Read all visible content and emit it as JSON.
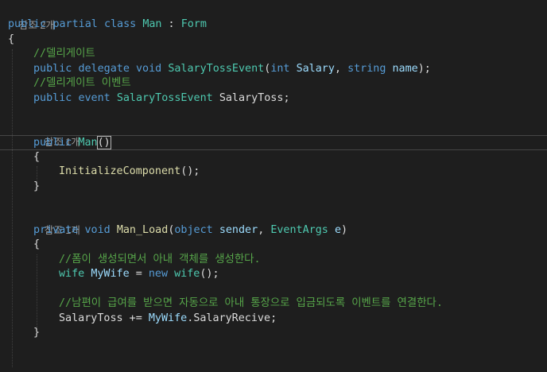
{
  "code": {
    "lens_class_refs": "참조 2개",
    "class_decl": {
      "kw_public": "public",
      "kw_partial": "partial",
      "kw_class": "class",
      "class_name": "Man",
      "colon": " : ",
      "base_type": "Form"
    },
    "open_brace": "{",
    "close_brace": "}",
    "comment_delegate": "//델리게이트",
    "delegate_decl": {
      "kw_public": "public",
      "kw_delegate": "delegate",
      "kw_void": "void",
      "name": "SalaryTossEvent",
      "open_paren": "(",
      "kw_int": "int",
      "param1": "Salary",
      "comma": ", ",
      "kw_string": "string",
      "param2": "name",
      "close": ");"
    },
    "comment_event": "//델리게이트 이벤트",
    "event_decl": {
      "kw_public": "public",
      "kw_event": "event",
      "type": "SalaryTossEvent",
      "name": "SalaryToss",
      "semi": ";"
    },
    "lens_ctor_refs": "참조 1개",
    "ctor_decl": {
      "kw_public": "public",
      "name": "Man",
      "parens": "()"
    },
    "init_call": {
      "name": "InitializeComponent",
      "rest": "();"
    },
    "lens_load_refs": "참조 1개",
    "load_decl": {
      "kw_private": "private",
      "kw_void": "void",
      "name": "Man_Load",
      "open_paren": "(",
      "kw_object": "object",
      "param1": "sender",
      "comma": ", ",
      "type2": "EventArgs",
      "param2": "e",
      "close_paren": ")"
    },
    "comment_create": "//폼이 생성되면서 아내 객체를 생성한다.",
    "wife_decl": {
      "type": "wife",
      "var": "MyWife",
      "eq": " = ",
      "kw_new": "new",
      "ctor": "wife",
      "rest": "();"
    },
    "comment_connect": "//남편이 급여를 받으면 자동으로 아내 통장으로 입금되도록 이벤트를 연결한다.",
    "subscribe": {
      "event": "SalaryToss",
      "op": " += ",
      "obj": "MyWife",
      "dot": ".",
      "method": "SalaryRecive",
      "semi": ";"
    }
  }
}
